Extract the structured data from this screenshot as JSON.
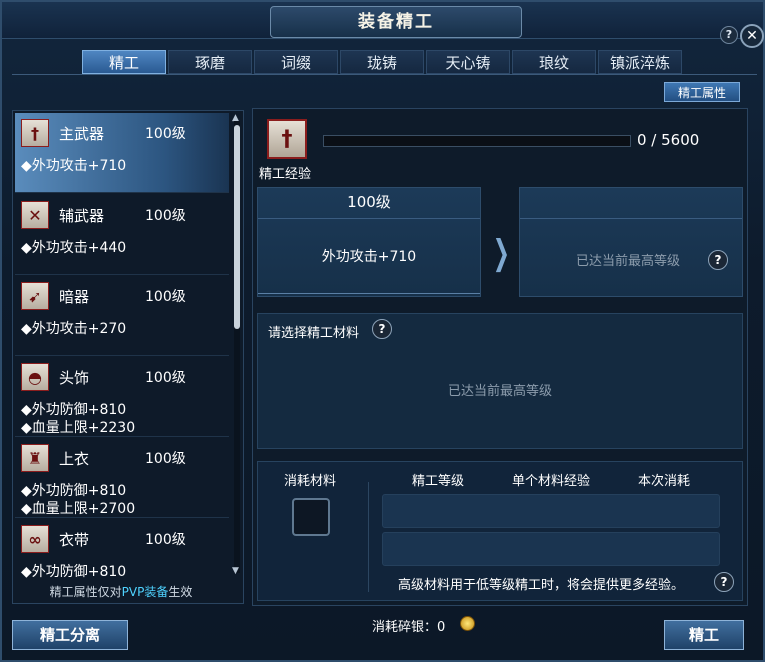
{
  "window": {
    "title": "装备精工",
    "help_label": "?",
    "close_label": "✕"
  },
  "tabs": [
    {
      "label": "精工",
      "active": true
    },
    {
      "label": "琢磨",
      "active": false
    },
    {
      "label": "词缀",
      "active": false
    },
    {
      "label": "珑铸",
      "active": false
    },
    {
      "label": "天心铸",
      "active": false
    },
    {
      "label": "琅纹",
      "active": false
    },
    {
      "label": "镇派淬炼",
      "active": false
    }
  ],
  "attr_button": "精工属性",
  "equipment_list": [
    {
      "name": "主武器",
      "level": "100级",
      "stats": [
        "◆外功攻击+710"
      ],
      "icon": "sword-icon",
      "selected": true
    },
    {
      "name": "辅武器",
      "level": "100级",
      "stats": [
        "◆外功攻击+440"
      ],
      "icon": "crossed-blades-icon",
      "selected": false
    },
    {
      "name": "暗器",
      "level": "100级",
      "stats": [
        "◆外功攻击+270"
      ],
      "icon": "dart-icon",
      "selected": false
    },
    {
      "name": "头饰",
      "level": "100级",
      "stats": [
        "◆外功防御+810",
        "◆血量上限+2230"
      ],
      "icon": "helmet-icon",
      "selected": false
    },
    {
      "name": "上衣",
      "level": "100级",
      "stats": [
        "◆外功防御+810",
        "◆血量上限+2700"
      ],
      "icon": "robe-icon",
      "selected": false
    },
    {
      "name": "衣带",
      "level": "100级",
      "stats": [
        "◆外功防御+810"
      ],
      "icon": "belt-icon",
      "selected": false
    }
  ],
  "left_note": {
    "prefix": "精工属性仅对",
    "highlight": "PVP装备",
    "suffix": "生效"
  },
  "exp": {
    "label": "精工经验",
    "current": 0,
    "max": 5600,
    "text": "0 / 5600"
  },
  "compare": {
    "current_level": "100级",
    "current_stat": "外功攻击+710",
    "next_msg": "已达当前最高等级"
  },
  "material": {
    "label": "请选择精工材料",
    "msg": "已达当前最高等级"
  },
  "cost": {
    "consume_label": "消耗材料",
    "col_level": "精工等级",
    "col_exp": "单个材料经验",
    "col_cost": "本次消耗",
    "tip": "高级材料用于低等级精工时，将会提供更多经验。"
  },
  "bottom": {
    "split_button": "精工分离",
    "silver_label": "消耗碎银：",
    "silver_value": "0",
    "refine_button": "精工"
  },
  "colors": {
    "accent": "#4f86c2",
    "highlight": "#4fd3ff",
    "muted": "#8c9cac"
  }
}
